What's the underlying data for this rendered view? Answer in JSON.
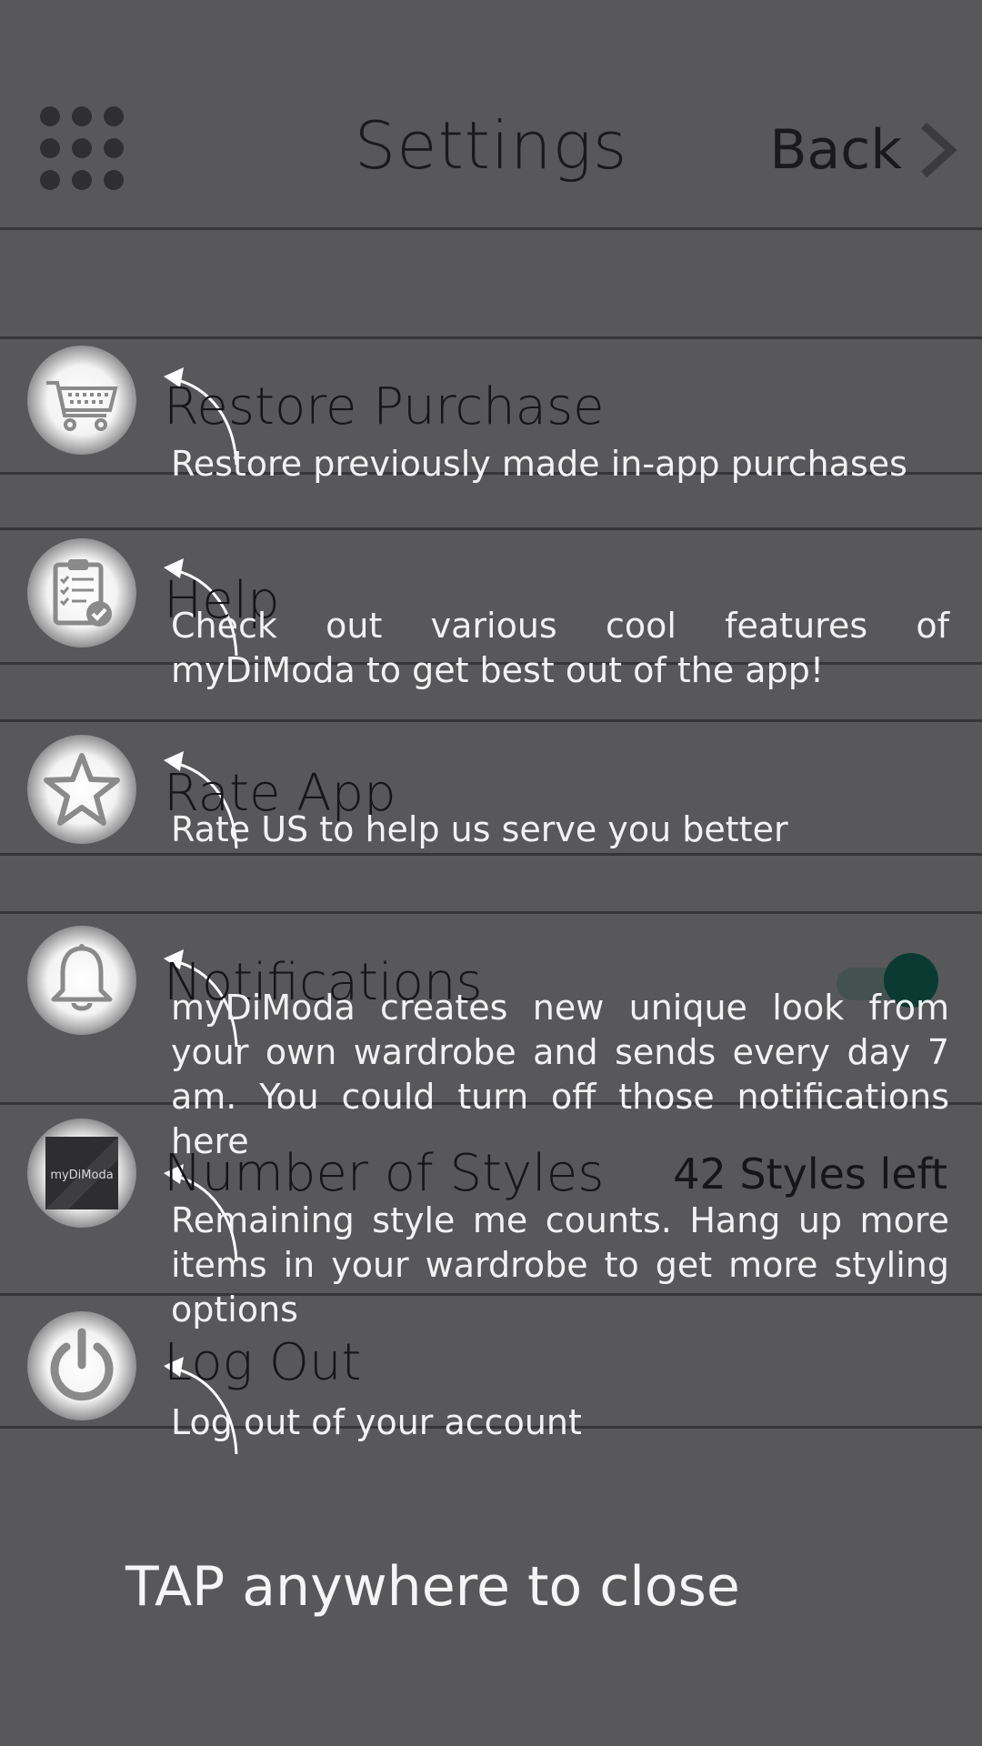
{
  "header": {
    "title": "Settings",
    "back_label": "Back"
  },
  "rows": [
    {
      "title": "Restore Purchase",
      "description": "Restore previously made in-app purchases",
      "icon": "cart-icon"
    },
    {
      "title": "Help",
      "description": "Check out various cool features of myDiModa to get best out of the app!",
      "icon": "clipboard-check-icon"
    },
    {
      "title": "Rate App",
      "description": "Rate US to help us serve you better",
      "icon": "star-icon"
    },
    {
      "title": "Notifications",
      "description": "myDiModa creates new unique look from your own wardrobe and sends every day 7 am. You could turn off those notifications here",
      "icon": "bell-icon",
      "toggle_on": true
    },
    {
      "title": "Number of Styles",
      "value": "42 Styles left",
      "description": "Remaining style me counts. Hang up more items in your wardrobe to get more styling options",
      "icon": "mydimoda-logo-icon",
      "logo_text": "myDiModa"
    },
    {
      "title": "Log Out",
      "description": "Log out of your account",
      "icon": "power-icon"
    }
  ],
  "overlay": {
    "tap_to_close": "TAP anywhere to close"
  },
  "colors": {
    "background": "#58585a",
    "toggle_knob": "#0b3a33",
    "toggle_track": "#44524f"
  }
}
